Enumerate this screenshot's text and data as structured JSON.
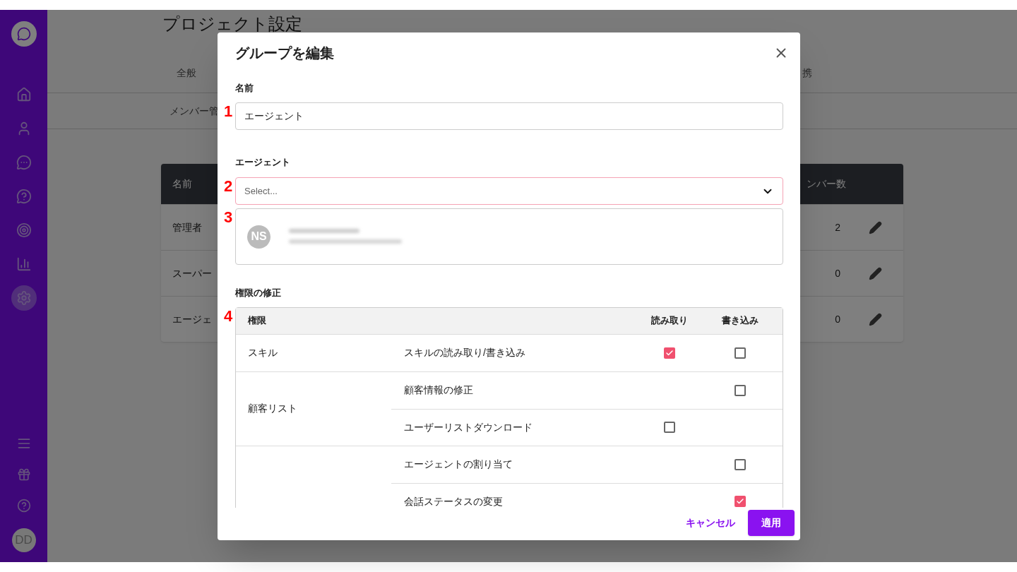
{
  "sidebar": {
    "nav": [
      {
        "selected": false
      },
      {
        "selected": false
      },
      {
        "selected": false
      },
      {
        "selected": false
      },
      {
        "selected": false
      },
      {
        "selected": false
      },
      {
        "selected": true
      }
    ],
    "avatar": "DD"
  },
  "page": {
    "title": "プロジェクト設定",
    "tabs": [
      {
        "label": "全般",
        "selected": false
      },
      {
        "label": "携",
        "selected": false
      }
    ],
    "subtabs": [
      {
        "label": "メンバー管"
      }
    ],
    "table": {
      "columns": [
        "名前",
        "ンバー数"
      ],
      "rows": [
        {
          "name": "管理者",
          "count": "2"
        },
        {
          "name": "スーパー",
          "count": "0"
        },
        {
          "name": "エージェ",
          "count": "0"
        }
      ]
    }
  },
  "dialog": {
    "title": "グループを編集",
    "name_label": "名前",
    "name_marker": "1",
    "name_value": "エージェント",
    "agent_label": "エージェント",
    "agent_marker": "2",
    "agent_placeholder": "Select...",
    "agent_card_marker": "3",
    "agent_initials": "NS",
    "permissions_label": "権限の修正",
    "permissions_marker": "4",
    "columns": [
      "権限",
      "読み取り",
      "書き込み"
    ],
    "groups": [
      {
        "name": "スキル",
        "rows": [
          {
            "label": "スキルの読み取り/書き込み",
            "read": {
              "checked": true
            },
            "write": {
              "checked": false
            }
          }
        ]
      },
      {
        "name": "顧客リスト",
        "rows": [
          {
            "label": "顧客情報の修正",
            "write": {
              "checked": false
            }
          },
          {
            "label": "ユーザーリストダウンロード",
            "read": {
              "checked": false
            }
          }
        ]
      },
      {
        "rows": [
          {
            "label": "エージェントの割り当て",
            "write": {
              "checked": false
            }
          },
          {
            "label": "会話ステータスの変更",
            "write": {
              "checked": true
            }
          }
        ]
      }
    ],
    "cancel": "キャンセル",
    "apply": "適用"
  }
}
